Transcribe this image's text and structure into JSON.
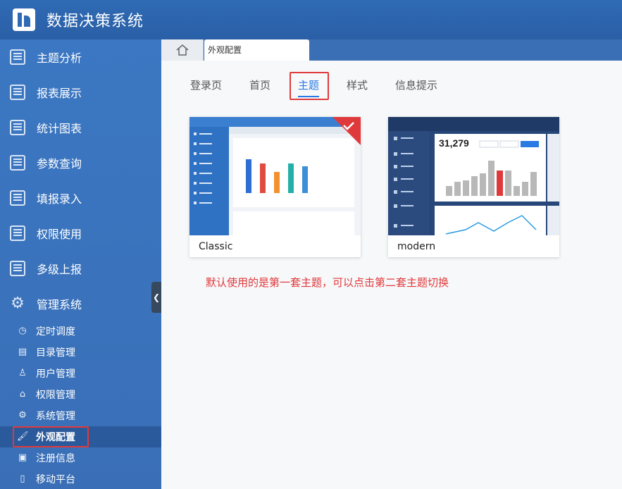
{
  "app": {
    "title": "数据决策系统"
  },
  "sidebar": {
    "items": [
      {
        "label": "主题分析",
        "icon": "report-icon"
      },
      {
        "label": "报表展示",
        "icon": "report-icon"
      },
      {
        "label": "统计图表",
        "icon": "report-icon"
      },
      {
        "label": "参数查询",
        "icon": "report-icon"
      },
      {
        "label": "填报录入",
        "icon": "report-icon"
      },
      {
        "label": "权限使用",
        "icon": "report-icon"
      },
      {
        "label": "多级上报",
        "icon": "report-icon"
      },
      {
        "label": "管理系统",
        "icon": "gear-icon"
      }
    ],
    "subitems": [
      {
        "label": "定时调度",
        "icon": "clock-icon"
      },
      {
        "label": "目录管理",
        "icon": "folder-icon"
      },
      {
        "label": "用户管理",
        "icon": "user-icon"
      },
      {
        "label": "权限管理",
        "icon": "lock-icon"
      },
      {
        "label": "系统管理",
        "icon": "gear-icon"
      },
      {
        "label": "外观配置",
        "icon": "paint-roller-icon",
        "active": true
      },
      {
        "label": "注册信息",
        "icon": "document-icon"
      },
      {
        "label": "移动平台",
        "icon": "mobile-icon"
      }
    ]
  },
  "tabstrip": {
    "current_tab": "外观配置"
  },
  "content": {
    "tabs": [
      "登录页",
      "首页",
      "主题",
      "样式",
      "信息提示"
    ],
    "active_tab": "主题",
    "themes": [
      {
        "name": "Classic",
        "selected": true
      },
      {
        "name": "modern",
        "selected": false
      }
    ],
    "note": "默认使用的是第一套主题，可以点击第二套主题切换"
  },
  "thumb_modern": {
    "kpi": "31,279"
  },
  "colors": {
    "accent": "#2b7ae3",
    "highlight": "#e0393b",
    "sidebar": "#3b77c2"
  }
}
